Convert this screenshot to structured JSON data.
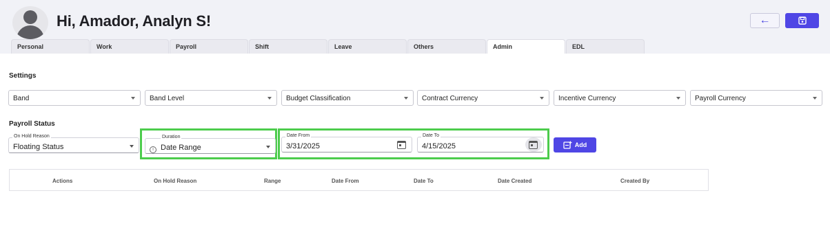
{
  "header": {
    "greeting": "Hi, Amador, Analyn S!",
    "back_icon": "arrow-left-icon",
    "save_icon": "floppy-disk-icon"
  },
  "tabs": [
    {
      "label": "Personal"
    },
    {
      "label": "Work"
    },
    {
      "label": "Payroll"
    },
    {
      "label": "Shift"
    },
    {
      "label": "Leave"
    },
    {
      "label": "Others"
    },
    {
      "label": "Admin",
      "active": true
    },
    {
      "label": "EDL"
    }
  ],
  "settings": {
    "title": "Settings",
    "selects": [
      {
        "label": "Band"
      },
      {
        "label": "Band Level"
      },
      {
        "label": "Budget Classification"
      },
      {
        "label": "Contract Currency"
      },
      {
        "label": "Incentive Currency"
      },
      {
        "label": "Payroll Currency"
      }
    ]
  },
  "payroll_status": {
    "title": "Payroll Status",
    "on_hold_reason": {
      "label": "On Hold Reason",
      "value": "Floating Status"
    },
    "duration": {
      "label": "Duration",
      "value": "Date Range",
      "icon": "info-icon"
    },
    "date_from": {
      "label": "Date From",
      "value": "3/31/2025"
    },
    "date_to": {
      "label": "Date To",
      "value": "4/15/2025"
    },
    "add_button": {
      "label": "Add",
      "icon": "add-note-icon"
    }
  },
  "table": {
    "columns": [
      "Actions",
      "On Hold Reason",
      "Range",
      "Date From",
      "Date To",
      "Date Created",
      "Created By"
    ]
  },
  "colors": {
    "accent": "#4f46e5",
    "highlight": "#4ccc4c",
    "header_bg": "#f1f2f7"
  }
}
